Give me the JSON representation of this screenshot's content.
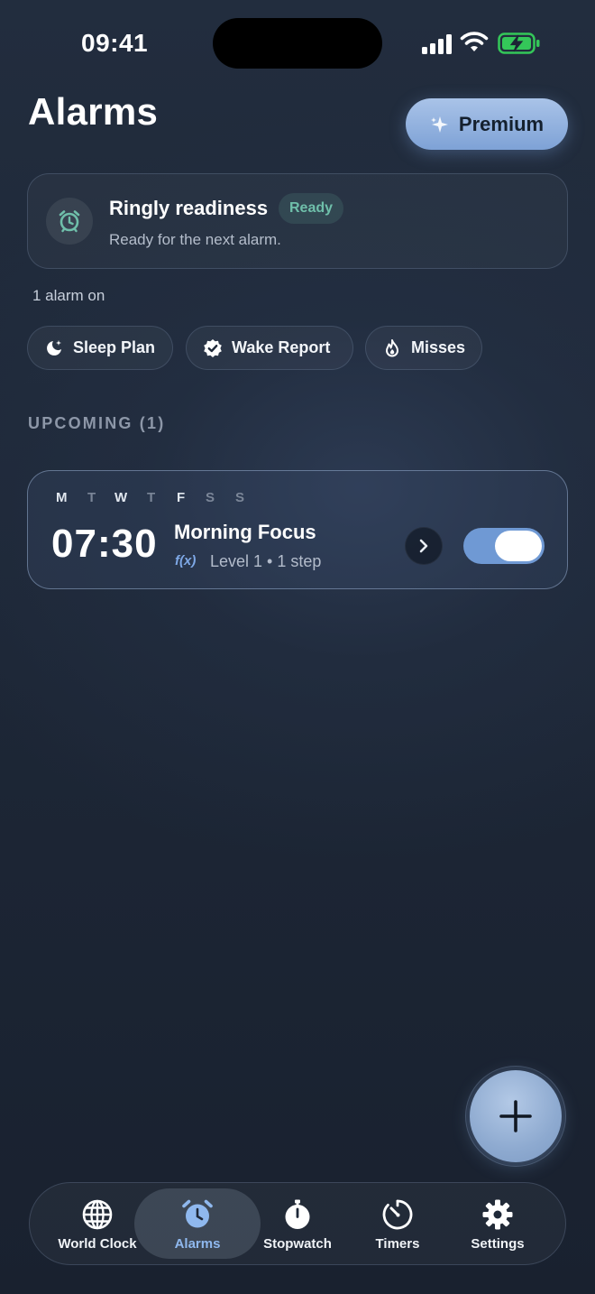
{
  "status_bar": {
    "time": "09:41"
  },
  "header": {
    "title": "Alarms",
    "premium_label": "Premium"
  },
  "readiness": {
    "title": "Ringly readiness",
    "badge": "Ready",
    "subtitle": "Ready for the next alarm.",
    "icon": "alarm-clock-icon"
  },
  "alarm_count": "1 alarm on",
  "chips": [
    {
      "label": "Sleep Plan",
      "icon": "moon-sparkle-icon"
    },
    {
      "label": "Wake Report",
      "icon": "verified-badge-icon"
    },
    {
      "label": "Misses",
      "icon": "flame-icon"
    }
  ],
  "section": {
    "upcoming": "UPCOMING (1)"
  },
  "alarm": {
    "days": [
      {
        "letter": "M",
        "active": true
      },
      {
        "letter": "T",
        "active": false
      },
      {
        "letter": "W",
        "active": true
      },
      {
        "letter": "T",
        "active": false
      },
      {
        "letter": "F",
        "active": true
      },
      {
        "letter": "S",
        "active": false
      },
      {
        "letter": "S",
        "active": false
      }
    ],
    "time": "07:30",
    "name": "Morning Focus",
    "task_icon_label": "f(x)",
    "detail": "Level 1 • 1 step",
    "enabled": true
  },
  "tabs": [
    {
      "label": "World Clock",
      "icon": "globe-icon",
      "active": false
    },
    {
      "label": "Alarms",
      "icon": "alarm-clock-icon",
      "active": true
    },
    {
      "label": "Stopwatch",
      "icon": "stopwatch-icon",
      "active": false
    },
    {
      "label": "Timers",
      "icon": "timer-icon",
      "active": false
    },
    {
      "label": "Settings",
      "icon": "gear-icon",
      "active": false
    }
  ],
  "colors": {
    "accent": "#6f99d4",
    "active_tab": "#8fb8ee",
    "ready_badge": "#6fbfaa",
    "battery": "#34c759"
  }
}
